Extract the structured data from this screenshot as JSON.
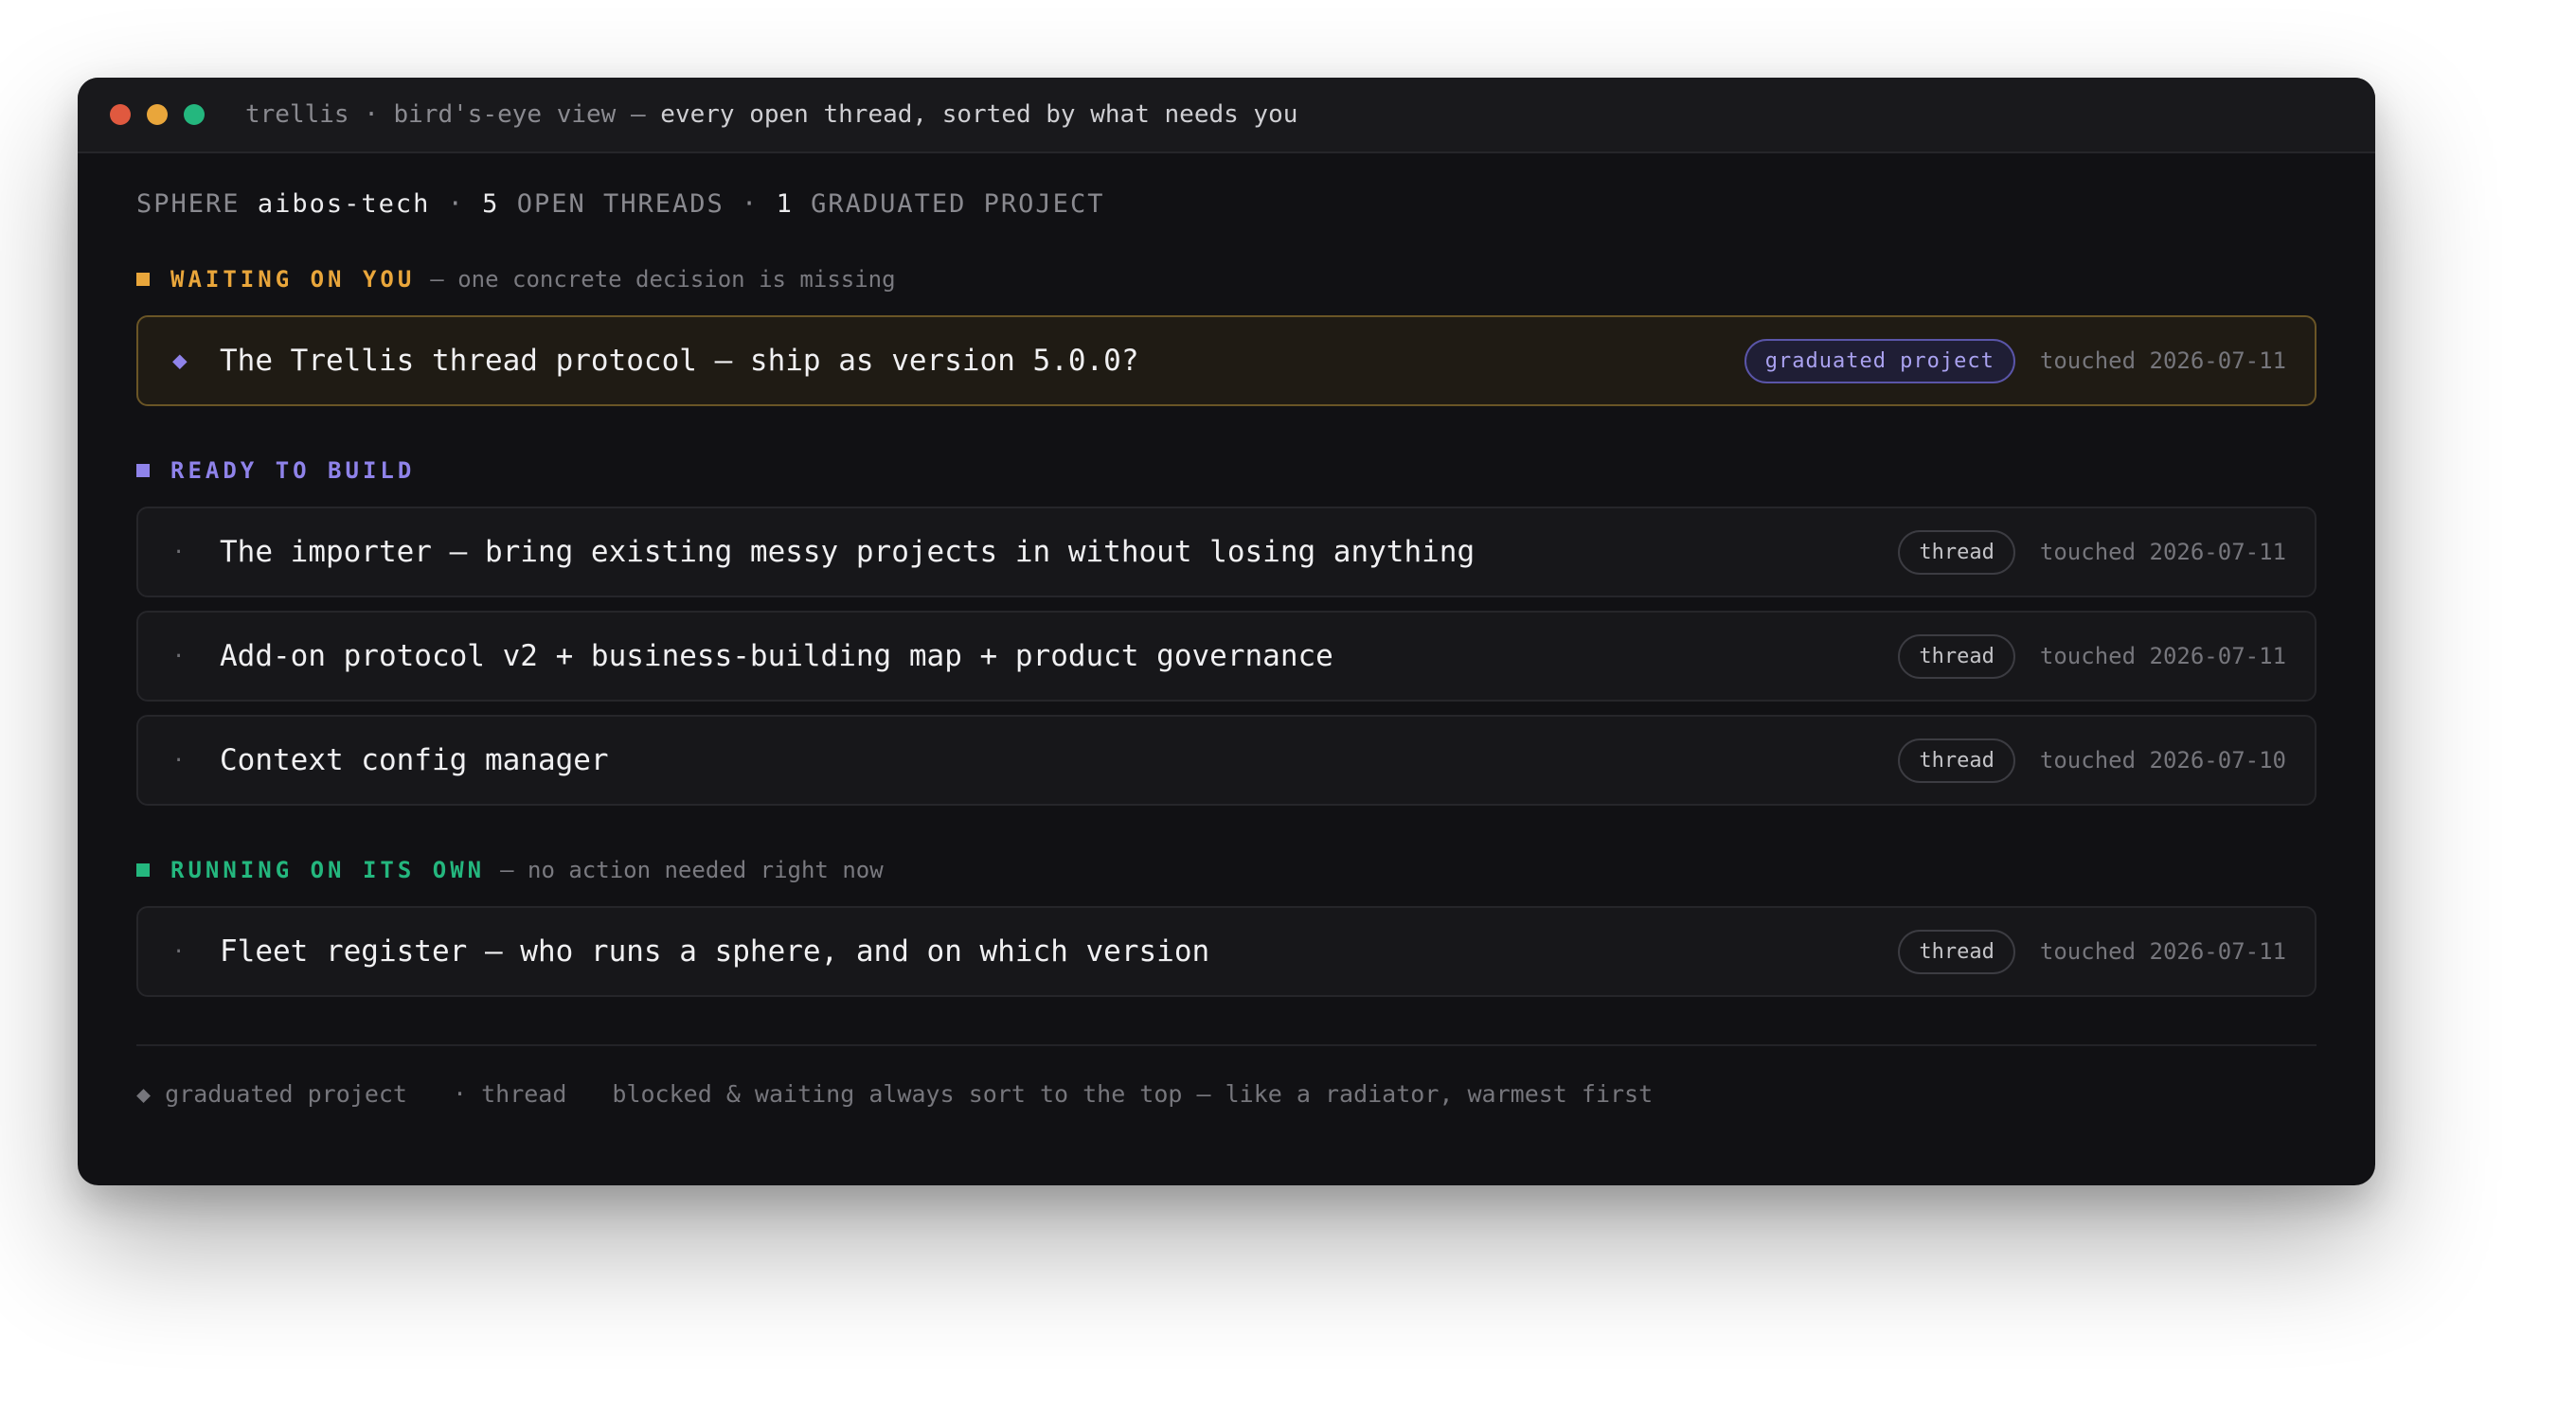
{
  "window": {
    "title_main": "trellis · bird's-eye view — ",
    "title_tail": "every open thread, sorted by what needs you"
  },
  "summary": {
    "sphere_label": "SPHERE",
    "sphere_name": "aibos-tech",
    "sep": "·",
    "open_count": "5",
    "open_label": "OPEN THREADS",
    "grad_count": "1",
    "grad_label": "GRADUATED PROJECT"
  },
  "sections": {
    "waiting": {
      "label": "WAITING ON YOU",
      "note": "— one concrete decision is missing",
      "color": "#e9a63b",
      "items": [
        {
          "bullet": "◆",
          "title": "The Trellis thread protocol — ship as version 5.0.0?",
          "badge": "graduated project",
          "touched": "touched 2026-07-11"
        }
      ]
    },
    "ready": {
      "label": "READY TO BUILD",
      "color": "#8f83ea",
      "items": [
        {
          "bullet": "·",
          "title": "The importer — bring existing messy projects in without losing anything",
          "badge": "thread",
          "touched": "touched 2026-07-11"
        },
        {
          "bullet": "·",
          "title": "Add-on protocol v2 + business-building map + product governance",
          "badge": "thread",
          "touched": "touched 2026-07-11"
        },
        {
          "bullet": "·",
          "title": "Context config manager",
          "badge": "thread",
          "touched": "touched 2026-07-10"
        }
      ]
    },
    "running": {
      "label": "RUNNING ON ITS OWN",
      "note": "— no action needed right now",
      "color": "#24b77e",
      "items": [
        {
          "bullet": "·",
          "title": "Fleet register — who runs a sphere, and on which version",
          "badge": "thread",
          "touched": "touched 2026-07-11"
        }
      ]
    }
  },
  "legend": {
    "graduated": "◆ graduated project",
    "thread": "· thread",
    "note": "blocked & waiting always sort to the top — like a radiator, warmest first"
  },
  "colors": {
    "background": "#111114",
    "accent_amber": "#e9a63b",
    "accent_violet": "#8f83ea",
    "accent_green": "#24b77e"
  }
}
